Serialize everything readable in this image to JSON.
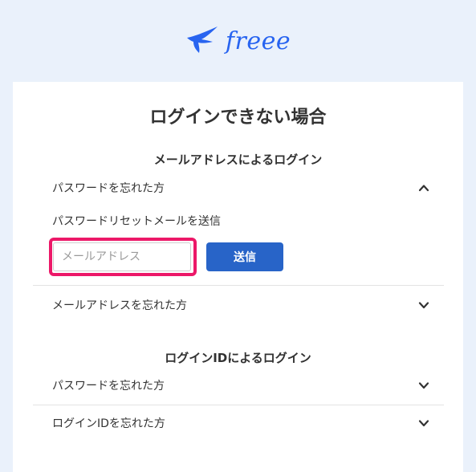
{
  "logo": {
    "text": "freee"
  },
  "page": {
    "title": "ログインできない場合"
  },
  "sections": [
    {
      "heading": "メールアドレスによるログイン",
      "items": [
        {
          "label": "パスワードを忘れた方",
          "expanded": true,
          "sub_label": "パスワードリセットメールを送信",
          "email_placeholder": "メールアドレス",
          "email_value": "",
          "submit_label": "送信"
        },
        {
          "label": "メールアドレスを忘れた方",
          "expanded": false
        }
      ]
    },
    {
      "heading": "ログインIDによるログイン",
      "items": [
        {
          "label": "パスワードを忘れた方",
          "expanded": false
        },
        {
          "label": "ログインIDを忘れた方",
          "expanded": false
        }
      ]
    }
  ],
  "colors": {
    "background": "#eaf1fb",
    "brand": "#2864f0",
    "button": "#2864c8",
    "highlight": "#ec1868",
    "text": "#323232"
  },
  "icons": {
    "logo": "freee-bird-icon",
    "expanded": "chevron-up-icon",
    "collapsed": "chevron-down-icon"
  }
}
